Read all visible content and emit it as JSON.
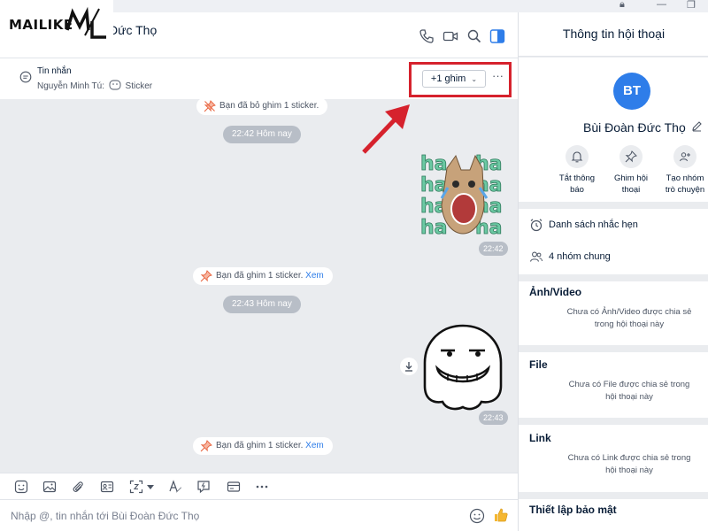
{
  "watermark": {
    "logo_text": "MAILIKE",
    "logo_mark": "ML"
  },
  "colors": {
    "accent": "#2e7de9",
    "highlight": "#d6222d",
    "conversation_bg": "#eaecef"
  },
  "header": {
    "contact_name": "Đức Thọ",
    "icons": [
      "phone-icon",
      "video-call-icon",
      "search-icon",
      "panel-toggle-icon"
    ]
  },
  "pinbar": {
    "title": "Tin nhắn",
    "sender": "Nguyễn Minh Tú:",
    "content": "Sticker",
    "pin_button": "+1 ghim",
    "more": "···"
  },
  "messages": {
    "note1": "Bạn đã bỏ ghim 1 sticker.",
    "time1": "22:42 Hôm nay",
    "stamp1": "22:42",
    "note2": "Bạn đã ghim 1 sticker.",
    "note2_link": "Xem",
    "time2": "22:43 Hôm nay",
    "stamp2": "22:43",
    "note3": "Bạn đã ghim 1 sticker.",
    "note3_link": "Xem",
    "cat_sticker_text": "ha"
  },
  "toolbar": {
    "icons": [
      "sticker-icon",
      "image-icon",
      "attachment-icon",
      "contact-card-icon",
      "screenshot-icon",
      "text-format-icon",
      "quick-message-icon",
      "card-icon",
      "more-icon"
    ]
  },
  "composer": {
    "placeholder": "Nhập @, tin nhắn tới Bùi Đoàn Đức Thọ"
  },
  "sidebar": {
    "title": "Thông tin hội thoại",
    "avatar_initials": "BT",
    "name": "Bùi Đoàn Đức Thọ",
    "actions": [
      {
        "line1": "Tắt thông",
        "line2": "báo"
      },
      {
        "line1": "Ghim hội",
        "line2": "thoại"
      },
      {
        "line1": "Tạo nhóm",
        "line2": "trò chuyện"
      }
    ],
    "reminders": "Danh sách nhắc hẹn",
    "common_groups": "4 nhóm chung",
    "media": {
      "title": "Ảnh/Video",
      "empty_line1": "Chưa có Ảnh/Video được chia sẻ",
      "empty_line2": "trong hội thoại này"
    },
    "files": {
      "title": "File",
      "empty_line1": "Chưa có File được chia sẻ trong",
      "empty_line2": "hội thoại này"
    },
    "links": {
      "title": "Link",
      "empty_line1": "Chưa có Link được chia sẻ trong",
      "empty_line2": "hội thoại này"
    },
    "security": "Thiết lập bảo mật"
  }
}
